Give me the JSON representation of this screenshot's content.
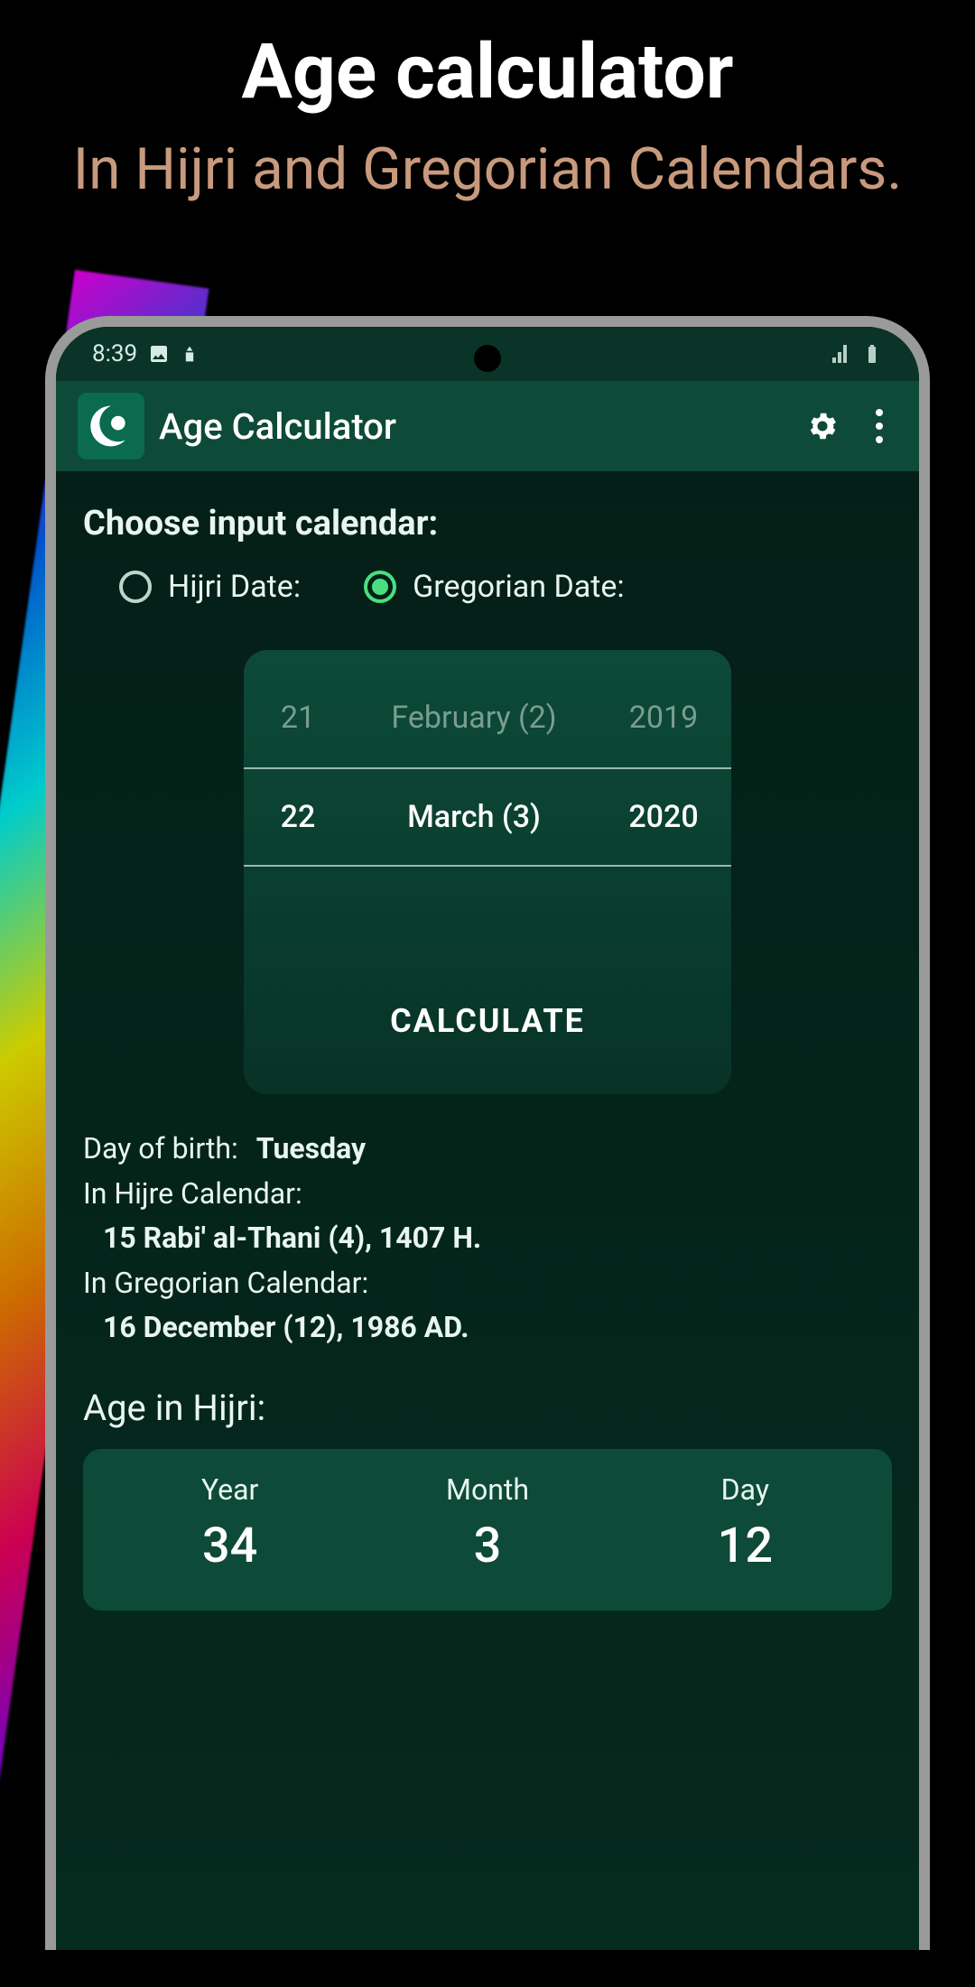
{
  "promo": {
    "title": "Age calculator",
    "subtitle": "In Hijri and Gregorian Calendars."
  },
  "status_bar": {
    "time": "8:39"
  },
  "app_bar": {
    "title": "Age Calculator"
  },
  "input_section": {
    "heading": "Choose input calendar:",
    "hijri_label": "Hijri Date:",
    "gregorian_label": "Gregorian Date:",
    "selected": "gregorian"
  },
  "picker": {
    "prev": {
      "day": "21",
      "month": "February (2)",
      "year": "2019"
    },
    "current": {
      "day": "22",
      "month": "March (3)",
      "year": "2020"
    },
    "calculate_label": "CALCULATE"
  },
  "results": {
    "dob_label": "Day of birth:",
    "dob_value": "Tuesday",
    "hijri_label": "In Hijre Calendar:",
    "hijri_value": "15 Rabi' al-Thani (4), 1407 H.",
    "gregorian_label": "In Gregorian Calendar:",
    "gregorian_value": "16 December (12), 1986 AD."
  },
  "age_hijri": {
    "title": "Age in Hijri:",
    "year_label": "Year",
    "year_value": "34",
    "month_label": "Month",
    "month_value": "3",
    "day_label": "Day",
    "day_value": "12"
  }
}
